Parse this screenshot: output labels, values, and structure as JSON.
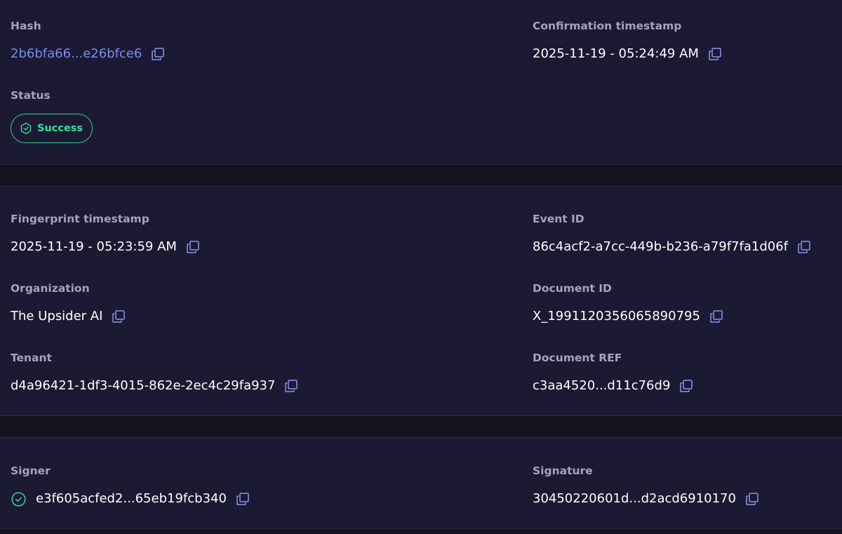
{
  "section1": {
    "hash": {
      "label": "Hash",
      "value": "2b6bfa66...e26bfce6"
    },
    "confirmation_timestamp": {
      "label": "Confirmation timestamp",
      "value": "2025-11-19 - 05:24:49 AM"
    },
    "status": {
      "label": "Status",
      "value": "Success"
    }
  },
  "section2": {
    "fingerprint_timestamp": {
      "label": "Fingerprint timestamp",
      "value": "2025-11-19 - 05:23:59 AM"
    },
    "event_id": {
      "label": "Event ID",
      "value": "86c4acf2-a7cc-449b-b236-a79f7fa1d06f"
    },
    "organization": {
      "label": "Organization",
      "value": "The Upsider AI"
    },
    "document_id": {
      "label": "Document ID",
      "value": "X_1991120356065890795"
    },
    "tenant": {
      "label": "Tenant",
      "value": "d4a96421-1df3-4015-862e-2ec4c29fa937"
    },
    "document_ref": {
      "label": "Document REF",
      "value": "c3aa4520...d11c76d9"
    }
  },
  "section3": {
    "signer": {
      "label": "Signer",
      "value": "e3f605acfed2...65eb19fcb340"
    },
    "signature": {
      "label": "Signature",
      "value": "30450220601d...d2acd6910170"
    }
  },
  "icons": {
    "copy": "copy-icon",
    "status": "shield-check-icon",
    "signer": "circle-check-icon"
  },
  "colors": {
    "background": "#13131f",
    "card": "#1b1a32",
    "label": "#a3a3b9",
    "value": "#ffffff",
    "link": "#7b8bf2",
    "copy_icon": "#8d95f0",
    "success": "#38e09b"
  }
}
